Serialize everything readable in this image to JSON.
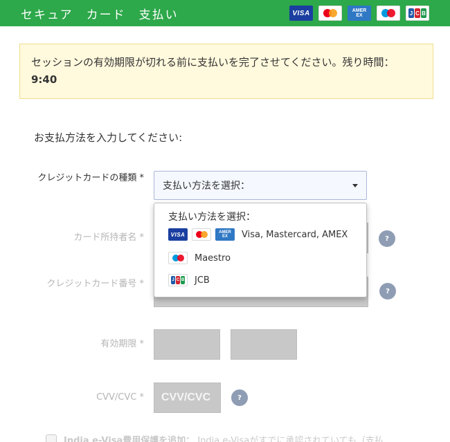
{
  "header": {
    "title": "セキュア　カード　支払い",
    "card_logos": [
      "VISA",
      "mastercard",
      "AMEX",
      "maestro",
      "JCB"
    ]
  },
  "warning": {
    "text": "セッションの有効期限が切れる前に支払いを完了させてください。残り時間：",
    "time_remaining": "9:40"
  },
  "form": {
    "section_title": "お支払方法を入力してください:",
    "card_type_label": "クレジットカードの種類 *",
    "card_type_value": "支払い方法を選択：",
    "cardholder_label": "カード所持者名 *",
    "card_number_label": "クレジットカード番号 *",
    "expiry_label": "有効期限 *",
    "cvv_label": "CVV/CVC *",
    "cvv_placeholder": "CVV/CVC",
    "help_glyph": "?"
  },
  "dropdown": {
    "header": "支払い方法を選択：",
    "options": [
      {
        "label": "Visa, Mastercard, AMEX",
        "icons": [
          "VISA",
          "mastercard",
          "AMEX"
        ]
      },
      {
        "label": "Maestro",
        "icons": [
          "maestro"
        ]
      },
      {
        "label": "JCB",
        "icons": [
          "JCB"
        ]
      }
    ]
  },
  "bottom": {
    "bold_text": "India e-Visa費用保護を追加：",
    "text": "India e-Visaがすでに承認されていても（支払"
  },
  "logo_text": {
    "visa": "VISA",
    "amex_top": "AMER",
    "amex_bottom": "EX",
    "jcb_j": "J",
    "jcb_c": "C",
    "jcb_b": "B"
  },
  "colors": {
    "header_bg": "#2da84a",
    "warning_bg": "#fff9dd",
    "help_bg": "#8f9db4",
    "disabled_field": "#c8c8c8"
  }
}
